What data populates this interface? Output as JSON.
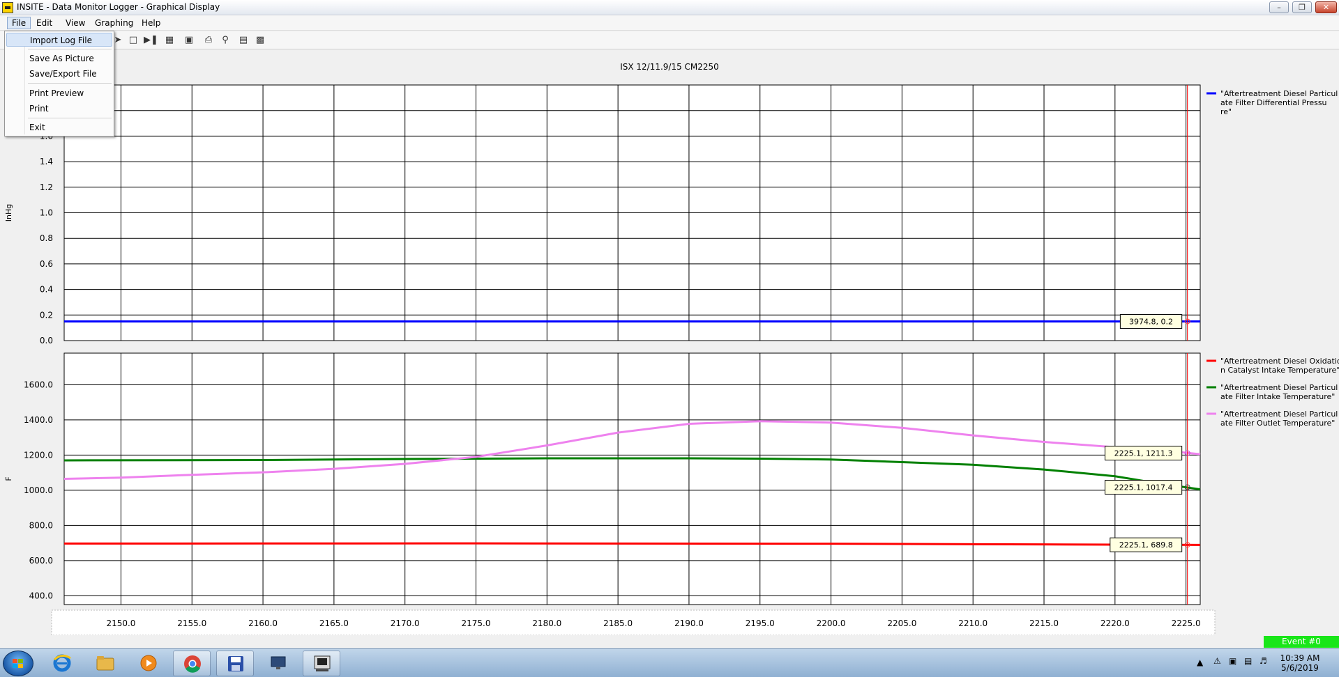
{
  "window": {
    "title": "INSITE - Data Monitor Logger - Graphical Display"
  },
  "menu": {
    "file": "File",
    "edit": "Edit",
    "view": "View",
    "graphing": "Graphing",
    "help": "Help"
  },
  "file_menu": {
    "import": "Import Log File",
    "save_picture": "Save As Picture",
    "save_export": "Save/Export File",
    "print_preview": "Print Preview",
    "print": "Print",
    "exit": "Exit"
  },
  "chart_data": [
    {
      "type": "line",
      "title": "ISX 12/11.9/15 CM2250",
      "ylabel": "InHg",
      "ylim": [
        0,
        2.0
      ],
      "yticks": [
        "0.0",
        "0.2",
        "0.4",
        "0.6",
        "0.8",
        "1.0",
        "1.2",
        "1.4",
        "1.6"
      ],
      "xlim": [
        2146,
        2226
      ],
      "series": [
        {
          "name": "\"Aftertreatment Diesel Particulate Filter Differential Pressure\"",
          "color": "#0000ff",
          "x": [
            2146,
            2226
          ],
          "y": [
            0.15,
            0.15
          ]
        }
      ],
      "cursor_label": "3974.8, 0.2"
    },
    {
      "type": "line",
      "ylabel": "F",
      "ylim": [
        350,
        1780
      ],
      "yticks": [
        "400.0",
        "600.0",
        "800.0",
        "1000.0",
        "1200.0",
        "1400.0",
        "1600.0"
      ],
      "xlabel": "",
      "xlim": [
        2146,
        2226
      ],
      "xticks": [
        "2150.0",
        "2155.0",
        "2160.0",
        "2165.0",
        "2170.0",
        "2175.0",
        "2180.0",
        "2185.0",
        "2190.0",
        "2195.0",
        "2200.0",
        "2205.0",
        "2210.0",
        "2215.0",
        "2220.0",
        "2225.0"
      ],
      "series": [
        {
          "name": "\"Aftertreatment Diesel Oxidation Catalyst Intake Temperature\"",
          "color": "#ff0000",
          "x": [
            2146,
            2175,
            2200,
            2215,
            2226
          ],
          "y": [
            697,
            698,
            696,
            692,
            689
          ]
        },
        {
          "name": "\"Aftertreatment Diesel Particulate Filter Intake Temperature\"",
          "color": "#008000",
          "x": [
            2146,
            2160,
            2170,
            2180,
            2190,
            2195,
            2200,
            2205,
            2210,
            2215,
            2220,
            2223,
            2226
          ],
          "y": [
            1170,
            1172,
            1178,
            1182,
            1182,
            1180,
            1175,
            1160,
            1145,
            1118,
            1080,
            1040,
            1005
          ]
        },
        {
          "name": "\"Aftertreatment Diesel Particulate Filter Outlet Temperature\"",
          "color": "#ee82ee",
          "x": [
            2146,
            2150,
            2155,
            2160,
            2165,
            2170,
            2175,
            2180,
            2185,
            2190,
            2195,
            2200,
            2205,
            2210,
            2215,
            2220,
            2222,
            2226
          ],
          "y": [
            1065,
            1072,
            1088,
            1102,
            1122,
            1150,
            1190,
            1255,
            1328,
            1378,
            1393,
            1385,
            1355,
            1312,
            1275,
            1245,
            1238,
            1205
          ]
        }
      ],
      "cursor_labels": [
        "2225.1, 1211.3",
        "2225.1, 1017.4",
        "2225.1, 689.8"
      ]
    }
  ],
  "legend_top": [
    "\"Aftertreatment Diesel Particul",
    "ate Filter Differential Pressu",
    "re\""
  ],
  "legend_bottom": [
    [
      "\"Aftertreatment Diesel Oxidatio",
      "n Catalyst Intake Temperature\""
    ],
    [
      "\"Aftertreatment Diesel Particul",
      "ate Filter Intake Temperature\""
    ],
    [
      "\"Aftertreatment Diesel Particul",
      "ate Filter Outlet Temperature\""
    ]
  ],
  "status": {
    "event": "Event #0"
  },
  "clock": {
    "time": "10:39 AM",
    "date": "5/6/2019"
  }
}
